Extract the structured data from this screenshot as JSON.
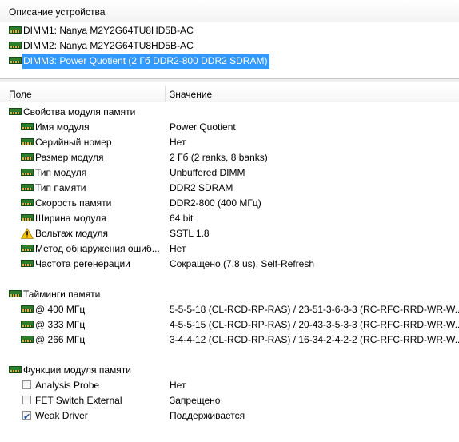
{
  "device_panel": {
    "header": "Описание устройства",
    "items": [
      {
        "label": "DIMM1: Nanya M2Y2G64TU8HD5B-AC",
        "selected": false,
        "icon": "dimm-icon"
      },
      {
        "label": "DIMM2: Nanya M2Y2G64TU8HD5B-AC",
        "selected": false,
        "icon": "dimm-icon"
      },
      {
        "label": "DIMM3: Power Quotient (2 Гб DDR2-800 DDR2 SDRAM)",
        "selected": true,
        "icon": "dimm-icon"
      }
    ]
  },
  "columns": {
    "field": "Поле",
    "value": "Значение"
  },
  "sections": {
    "properties": {
      "title": "Свойства модуля памяти",
      "rows": [
        {
          "field": "Имя модуля",
          "value": "Power Quotient",
          "icon": "dimm-icon"
        },
        {
          "field": "Серийный номер",
          "value": "Нет",
          "icon": "dimm-icon"
        },
        {
          "field": "Размер модуля",
          "value": "2 Гб (2 ranks, 8 banks)",
          "icon": "dimm-icon"
        },
        {
          "field": "Тип модуля",
          "value": "Unbuffered DIMM",
          "icon": "dimm-icon"
        },
        {
          "field": "Тип памяти",
          "value": "DDR2 SDRAM",
          "icon": "dimm-icon"
        },
        {
          "field": "Скорость памяти",
          "value": "DDR2-800 (400 МГц)",
          "icon": "dimm-icon"
        },
        {
          "field": "Ширина модуля",
          "value": "64 bit",
          "icon": "dimm-icon"
        },
        {
          "field": "Вольтаж модуля",
          "value": "SSTL 1.8",
          "icon": "warning-icon"
        },
        {
          "field": "Метод обнаружения ошиб...",
          "value": "Нет",
          "icon": "dimm-icon"
        },
        {
          "field": "Частота регенерации",
          "value": "Сокращено (7.8 us), Self-Refresh",
          "icon": "dimm-icon"
        }
      ]
    },
    "timings": {
      "title": "Тайминги памяти",
      "rows": [
        {
          "field": "@ 400 МГц",
          "value": "5-5-5-18  (CL-RCD-RP-RAS) / 23-51-3-6-3-3  (RC-RFC-RRD-WR-W...",
          "icon": "dimm-icon"
        },
        {
          "field": "@ 333 МГц",
          "value": "4-5-5-15  (CL-RCD-RP-RAS) / 20-43-3-5-3-3  (RC-RFC-RRD-WR-W...",
          "icon": "dimm-icon"
        },
        {
          "field": "@ 266 МГц",
          "value": "3-4-4-12  (CL-RCD-RP-RAS) / 16-34-2-4-2-2  (RC-RFC-RRD-WR-W...",
          "icon": "dimm-icon"
        }
      ]
    },
    "features": {
      "title": "Функции модуля памяти",
      "rows": [
        {
          "field": "Analysis Probe",
          "value": "Нет",
          "checked": false
        },
        {
          "field": "FET Switch External",
          "value": "Запрещено",
          "checked": false
        },
        {
          "field": "Weak Driver",
          "value": "Поддерживается",
          "checked": true
        }
      ]
    }
  },
  "colors": {
    "selection": "#3399ff",
    "dimm_green": "#2e7d2e",
    "warning_yellow": "#f5c400"
  }
}
